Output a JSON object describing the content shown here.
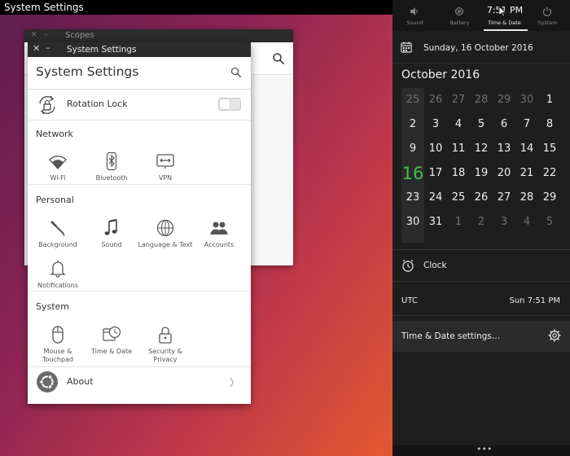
{
  "topbar": {
    "title": "System Settings"
  },
  "scopes_window": {
    "title": "Scopes"
  },
  "settings_window": {
    "titlebar": "System Settings",
    "heading": "System Settings",
    "rotation_lock": {
      "label": "Rotation Lock",
      "enabled": false
    },
    "sections": [
      {
        "title": "Network",
        "items": [
          {
            "label": "Wi-Fi",
            "icon": "wifi-icon"
          },
          {
            "label": "Bluetooth",
            "icon": "bluetooth-icon"
          },
          {
            "label": "VPN",
            "icon": "vpn-icon"
          }
        ]
      },
      {
        "title": "Personal",
        "items": [
          {
            "label": "Background",
            "icon": "paintbrush-icon"
          },
          {
            "label": "Sound",
            "icon": "music-note-icon"
          },
          {
            "label": "Language & Text",
            "icon": "globe-icon"
          },
          {
            "label": "Accounts",
            "icon": "accounts-icon"
          },
          {
            "label": "Notifications",
            "icon": "bell-icon"
          }
        ]
      },
      {
        "title": "System",
        "items": [
          {
            "label_line1": "Mouse &",
            "label_line2": "Touchpad",
            "icon": "mouse-icon"
          },
          {
            "label": "Time & Date",
            "icon": "calendar-clock-icon"
          },
          {
            "label": "Security & Privacy",
            "icon": "lock-icon"
          }
        ]
      }
    ],
    "about": {
      "label": "About",
      "chevron": "〉"
    }
  },
  "indicator": {
    "tabs": [
      {
        "label": "Sound",
        "icon": "speaker-icon"
      },
      {
        "label": "Battery",
        "icon": "battery-icon"
      },
      {
        "label": "Time & Date",
        "time": "7:51 PM",
        "active": true
      },
      {
        "label": "System",
        "icon": "power-icon"
      }
    ],
    "date_text": "Sunday, 16 October 2016",
    "month_title": "October 2016",
    "calendar": {
      "rows": [
        [
          "25",
          "26",
          "27",
          "28",
          "29",
          "30",
          "1"
        ],
        [
          "2",
          "3",
          "4",
          "5",
          "6",
          "7",
          "8"
        ],
        [
          "9",
          "10",
          "11",
          "12",
          "13",
          "14",
          "15"
        ],
        [
          "16",
          "17",
          "18",
          "19",
          "20",
          "21",
          "22"
        ],
        [
          "23",
          "24",
          "25",
          "26",
          "27",
          "28",
          "29"
        ],
        [
          "30",
          "31",
          "1",
          "2",
          "3",
          "4",
          "5"
        ]
      ],
      "muted_prefix_row0": 6,
      "muted_suffix_row5": 5,
      "today": "16",
      "today_color": "#3fbf4a"
    },
    "clock_label": "Clock",
    "utc_label": "UTC",
    "utc_time": "Sun 7:51 PM",
    "settings_link": "Time & Date settings…",
    "handle_dots": "•••"
  }
}
